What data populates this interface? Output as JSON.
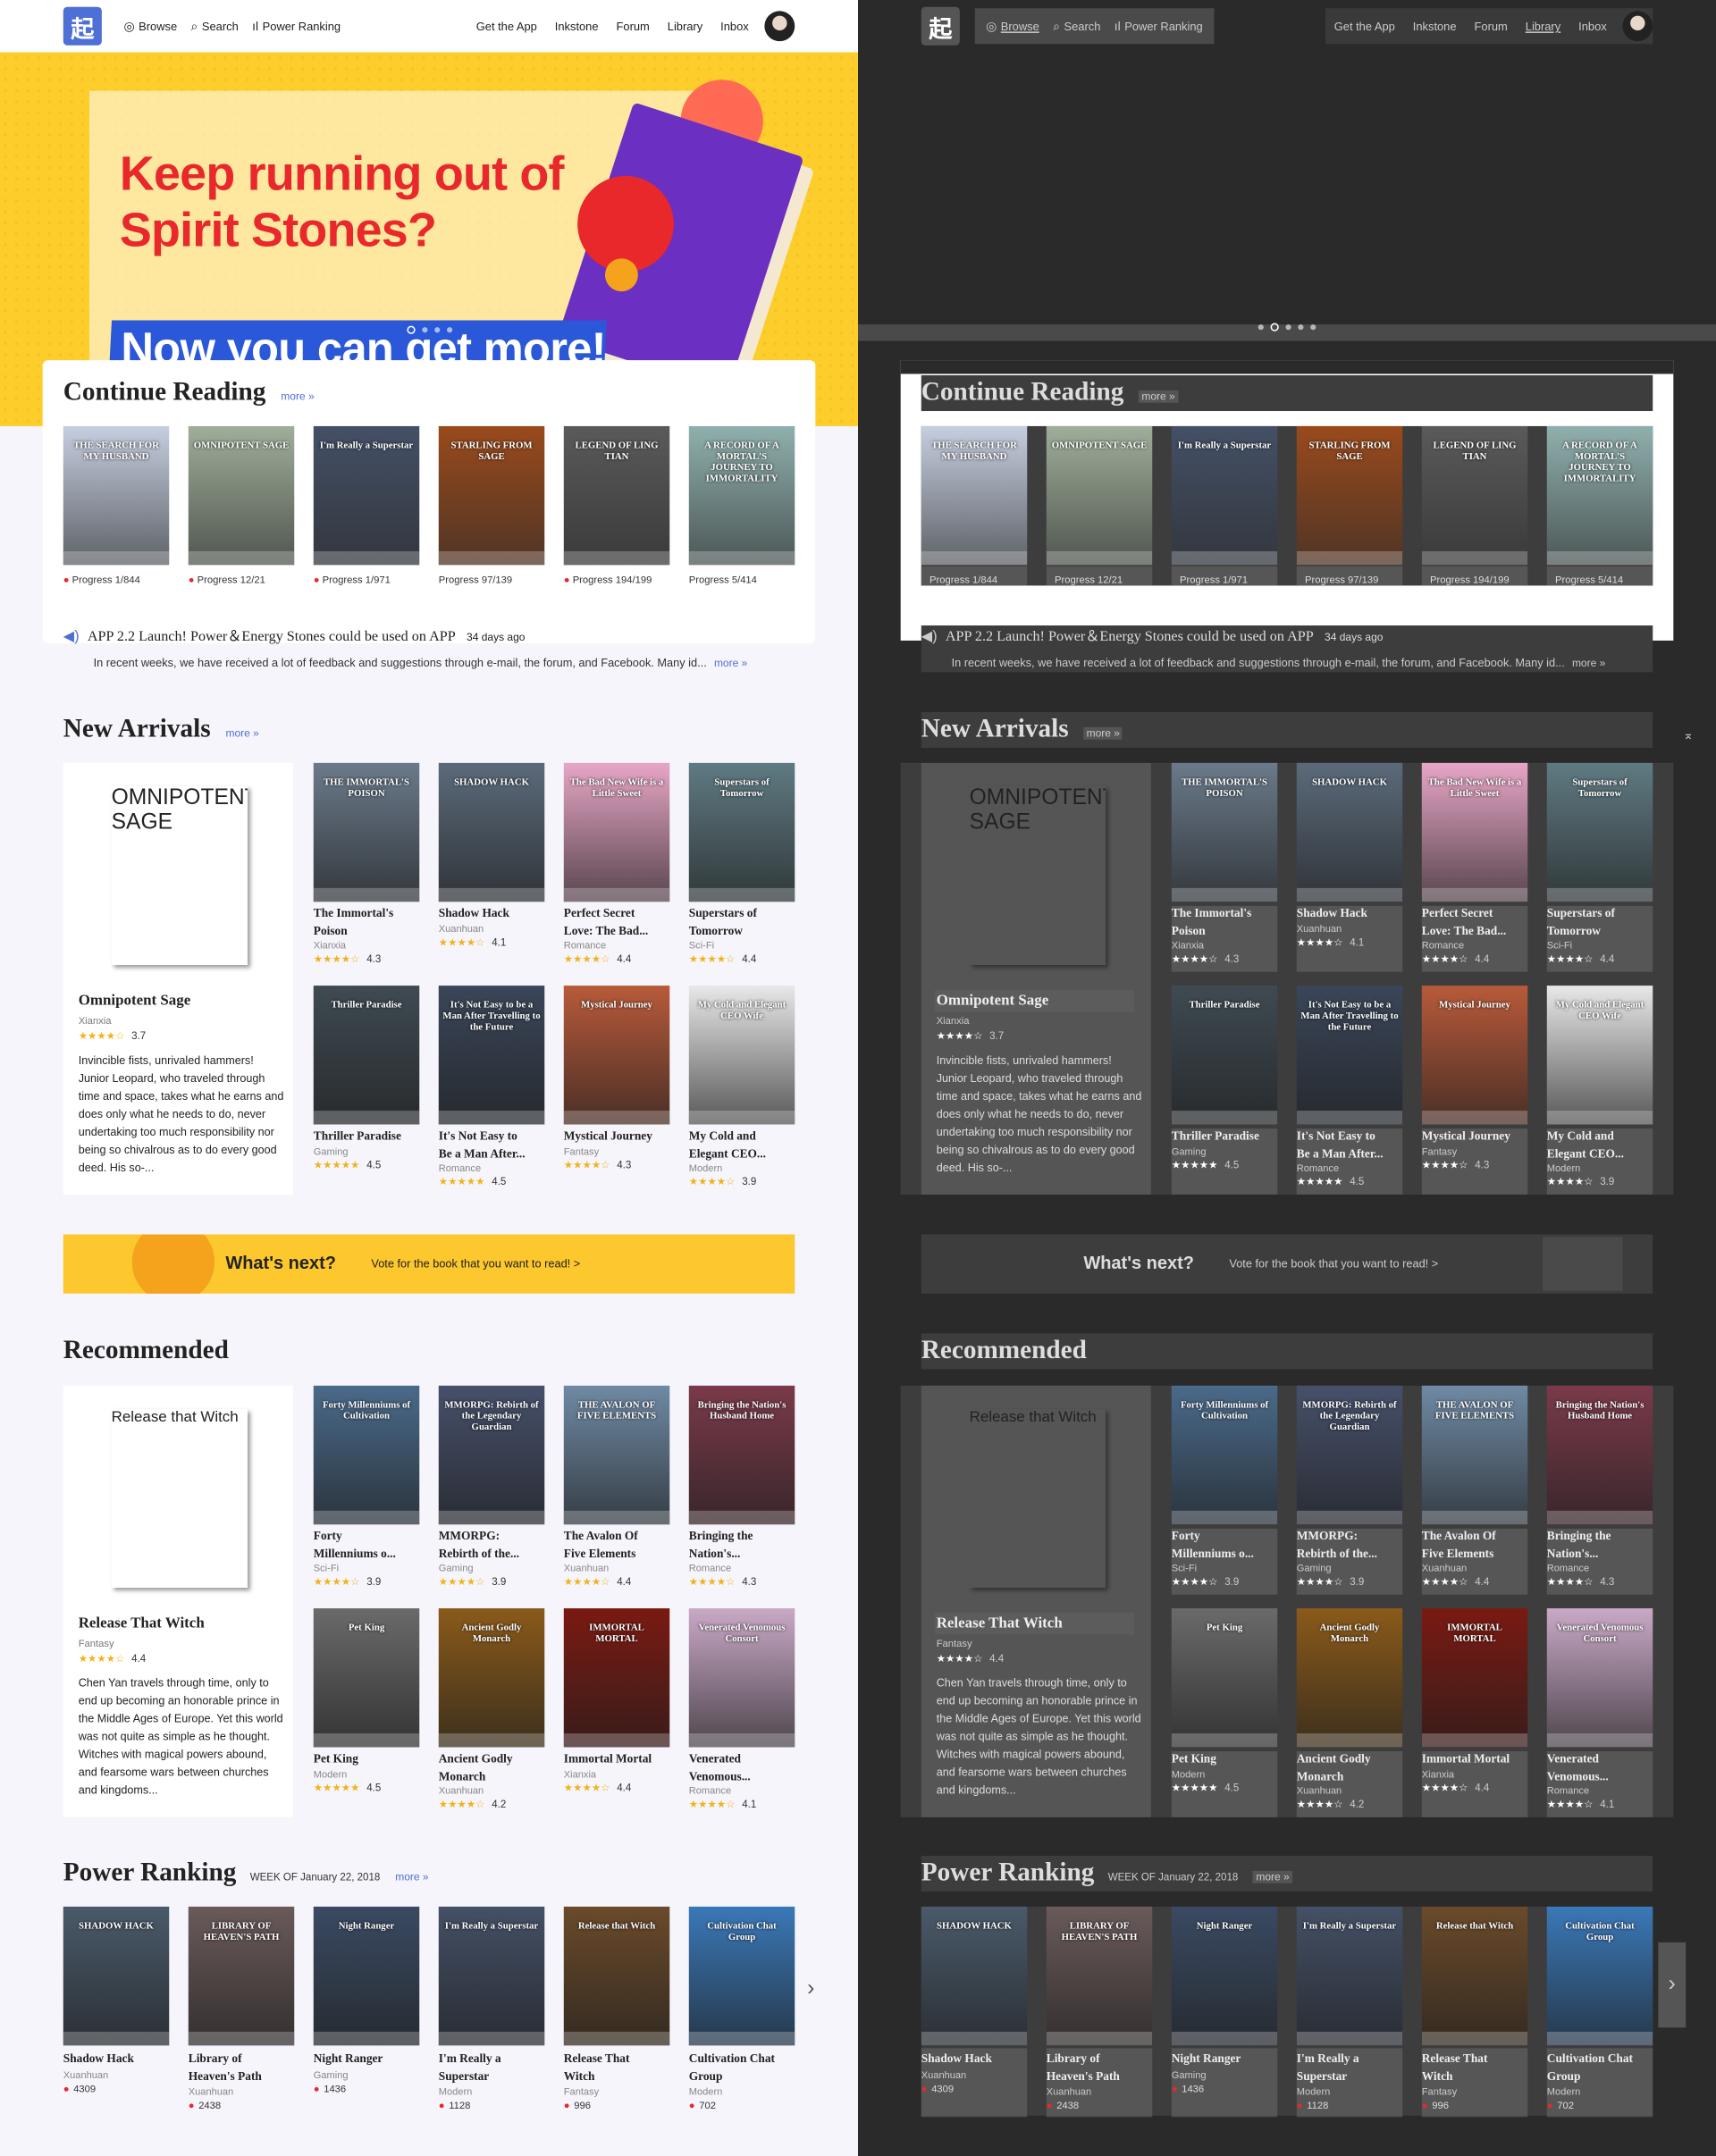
{
  "nav": {
    "logo": "起",
    "browse": "Browse",
    "search": "Search",
    "power": "Power Ranking",
    "get_app": "Get the App",
    "inkstone": "Inkstone",
    "forum": "Forum",
    "library": "Library",
    "inbox": "Inbox"
  },
  "hero": {
    "line1": "Keep running out of",
    "line2": "Spirit Stones?",
    "line3": "Now you can get more!"
  },
  "continue": {
    "title": "Continue Reading",
    "more": "more »",
    "books": [
      {
        "title": "THE SEARCH FOR MY HUSBAND",
        "cover": "#c6cfe0",
        "progress": "Progress 1/844",
        "dot": true
      },
      {
        "title": "OMNIPOTENT SAGE",
        "cover": "#9fae9a",
        "progress": "Progress 12/21",
        "dot": true
      },
      {
        "title": "I'm Really a Superstar",
        "cover": "#445066",
        "progress": "Progress 1/971",
        "dot": true
      },
      {
        "title": "STARLING FROM SAGE",
        "cover": "#9a4a1c",
        "progress": "Progress 97/139",
        "dot": false
      },
      {
        "title": "LEGEND OF LING TIAN",
        "cover": "#5a5a5a",
        "progress": "Progress 194/199",
        "dot": true
      },
      {
        "title": "A RECORD OF A MORTAL'S JOURNEY TO IMMORTALITY",
        "cover": "#8fb0ae",
        "progress": "Progress 5/414",
        "dot": false
      }
    ]
  },
  "announce": {
    "title": "APP 2.2 Launch! Power＆Energy Stones could be used on APP",
    "ago": "34 days ago",
    "body": "In recent weeks, we have received a lot of feedback and suggestions through e-mail, the forum, and Facebook. Many id...",
    "more": "more »"
  },
  "new_arrivals": {
    "title": "New Arrivals",
    "more": "more »",
    "featured": {
      "name": "Omnipotent Sage",
      "genre": "Xianxia",
      "stars": "★★★★☆",
      "score": "3.7",
      "desc": "Invincible fists, unrivaled hammers! Junior Leopard, who traveled through time and space, takes what he earns and does only what he needs to do, never undertaking too much responsibility nor being so chivalrous as to do every good deed. His so-...",
      "cover_title": "OMNIPOTENT SAGE",
      "cover": "#98a892"
    },
    "books": [
      {
        "t1": "The Immortal's",
        "t2": "Poison",
        "genre": "Xianxia",
        "score": "4.3",
        "cover": "#6a7a8a",
        "ct": "THE IMMORTAL'S POISON"
      },
      {
        "t1": "Shadow Hack",
        "t2": "",
        "genre": "Xuanhuan",
        "score": "4.1",
        "cover": "#5b6a7a",
        "ct": "SHADOW HACK"
      },
      {
        "t1": "Perfect Secret",
        "t2": "Love: The Bad...",
        "genre": "Romance",
        "score": "4.4",
        "cover": "#e7a6c6",
        "ct": "The Bad New Wife is a Little Sweet"
      },
      {
        "t1": "Superstars of",
        "t2": "Tomorrow",
        "genre": "Sci-Fi",
        "score": "4.4",
        "cover": "#5f7a82",
        "ct": "Superstars of Tomorrow"
      },
      {
        "t1": "Thriller Paradise",
        "t2": "",
        "genre": "Gaming",
        "score": "4.5",
        "cover": "#3f4a52",
        "ct": "Thriller Paradise"
      },
      {
        "t1": "It's Not Easy to",
        "t2": "Be a Man After...",
        "genre": "Romance",
        "score": "4.5",
        "cover": "#3a4658",
        "ct": "It's Not Easy to be a Man After Travelling to the Future"
      },
      {
        "t1": "Mystical Journey",
        "t2": "",
        "genre": "Fantasy",
        "score": "4.3",
        "cover": "#b85a3a",
        "ct": "Mystical Journey"
      },
      {
        "t1": "My Cold and",
        "t2": "Elegant CEO...",
        "genre": "Modern",
        "score": "3.9",
        "cover": "#e8e8e8",
        "ct": "My Cold and Elegant CEO Wife"
      }
    ]
  },
  "next": {
    "q": "What's next?",
    "v": "Vote for the book that you want to read! >"
  },
  "recommended": {
    "title": "Recommended",
    "featured": {
      "name": "Release That Witch",
      "genre": "Fantasy",
      "stars": "★★★★☆",
      "score": "4.4",
      "desc": "Chen Yan travels through time, only to end up becoming an honorable prince in the Middle Ages of Europe. Yet this world was not quite as simple as he thought. Witches with magical powers abound, and fearsome wars between churches and kingdoms...",
      "cover_title": "Release that Witch",
      "cover": "#6a4a2a"
    },
    "books": [
      {
        "t1": "Forty",
        "t2": "Millenniums o...",
        "genre": "Sci-Fi",
        "score": "3.9",
        "cover": "#4a6a8a",
        "ct": "Forty Millenniums of Cultivation"
      },
      {
        "t1": "MMORPG:",
        "t2": "Rebirth of the...",
        "genre": "Gaming",
        "score": "3.9",
        "cover": "#46506a",
        "ct": "MMORPG: Rebirth of the Legendary Guardian"
      },
      {
        "t1": "The Avalon Of",
        "t2": "Five Elements",
        "genre": "Xuanhuan",
        "score": "4.4",
        "cover": "#6f8aa4",
        "ct": "THE AVALON OF FIVE ELEMENTS"
      },
      {
        "t1": "Bringing the",
        "t2": "Nation's...",
        "genre": "Romance",
        "score": "4.3",
        "cover": "#7a3a4a",
        "ct": "Bringing the Nation's Husband Home"
      },
      {
        "t1": "Pet King",
        "t2": "",
        "genre": "Modern",
        "score": "4.5",
        "cover": "#6a6a6a",
        "ct": "Pet King"
      },
      {
        "t1": "Ancient Godly",
        "t2": "Monarch",
        "genre": "Xuanhuan",
        "score": "4.2",
        "cover": "#8a5a1a",
        "ct": "Ancient Godly Monarch"
      },
      {
        "t1": "Immortal Mortal",
        "t2": "",
        "genre": "Xianxia",
        "score": "4.4",
        "cover": "#7a1a12",
        "ct": "IMMORTAL MORTAL"
      },
      {
        "t1": "Venerated",
        "t2": "Venomous...",
        "genre": "Romance",
        "score": "4.1",
        "cover": "#c9a9c6",
        "ct": "Venerated Venomous Consort"
      }
    ]
  },
  "ranking": {
    "title": "Power Ranking",
    "week": "WEEK OF January 22, 2018",
    "more": "more »",
    "books": [
      {
        "t1": "Shadow Hack",
        "t2": "",
        "genre": "Xuanhuan",
        "votes": "4309",
        "cover": "#4a5a6a",
        "ct": "SHADOW HACK"
      },
      {
        "t1": "Library of",
        "t2": "Heaven's Path",
        "genre": "Xuanhuan",
        "votes": "2438",
        "cover": "#6a5a5a",
        "ct": "LIBRARY OF HEAVEN'S PATH"
      },
      {
        "t1": "Night Ranger",
        "t2": "",
        "genre": "Gaming",
        "votes": "1436",
        "cover": "#3a4a62",
        "ct": "Night Ranger"
      },
      {
        "t1": "I'm Really a",
        "t2": "Superstar",
        "genre": "Modern",
        "votes": "1128",
        "cover": "#445066",
        "ct": "I'm Really a Superstar"
      },
      {
        "t1": "Release That",
        "t2": "Witch",
        "genre": "Fantasy",
        "votes": "996",
        "cover": "#6a4a2a",
        "ct": "Release that Witch"
      },
      {
        "t1": "Cultivation Chat",
        "t2": "Group",
        "genre": "Modern",
        "votes": "702",
        "cover": "#3a78b8",
        "ct": "Cultivation Chat Group"
      }
    ]
  }
}
